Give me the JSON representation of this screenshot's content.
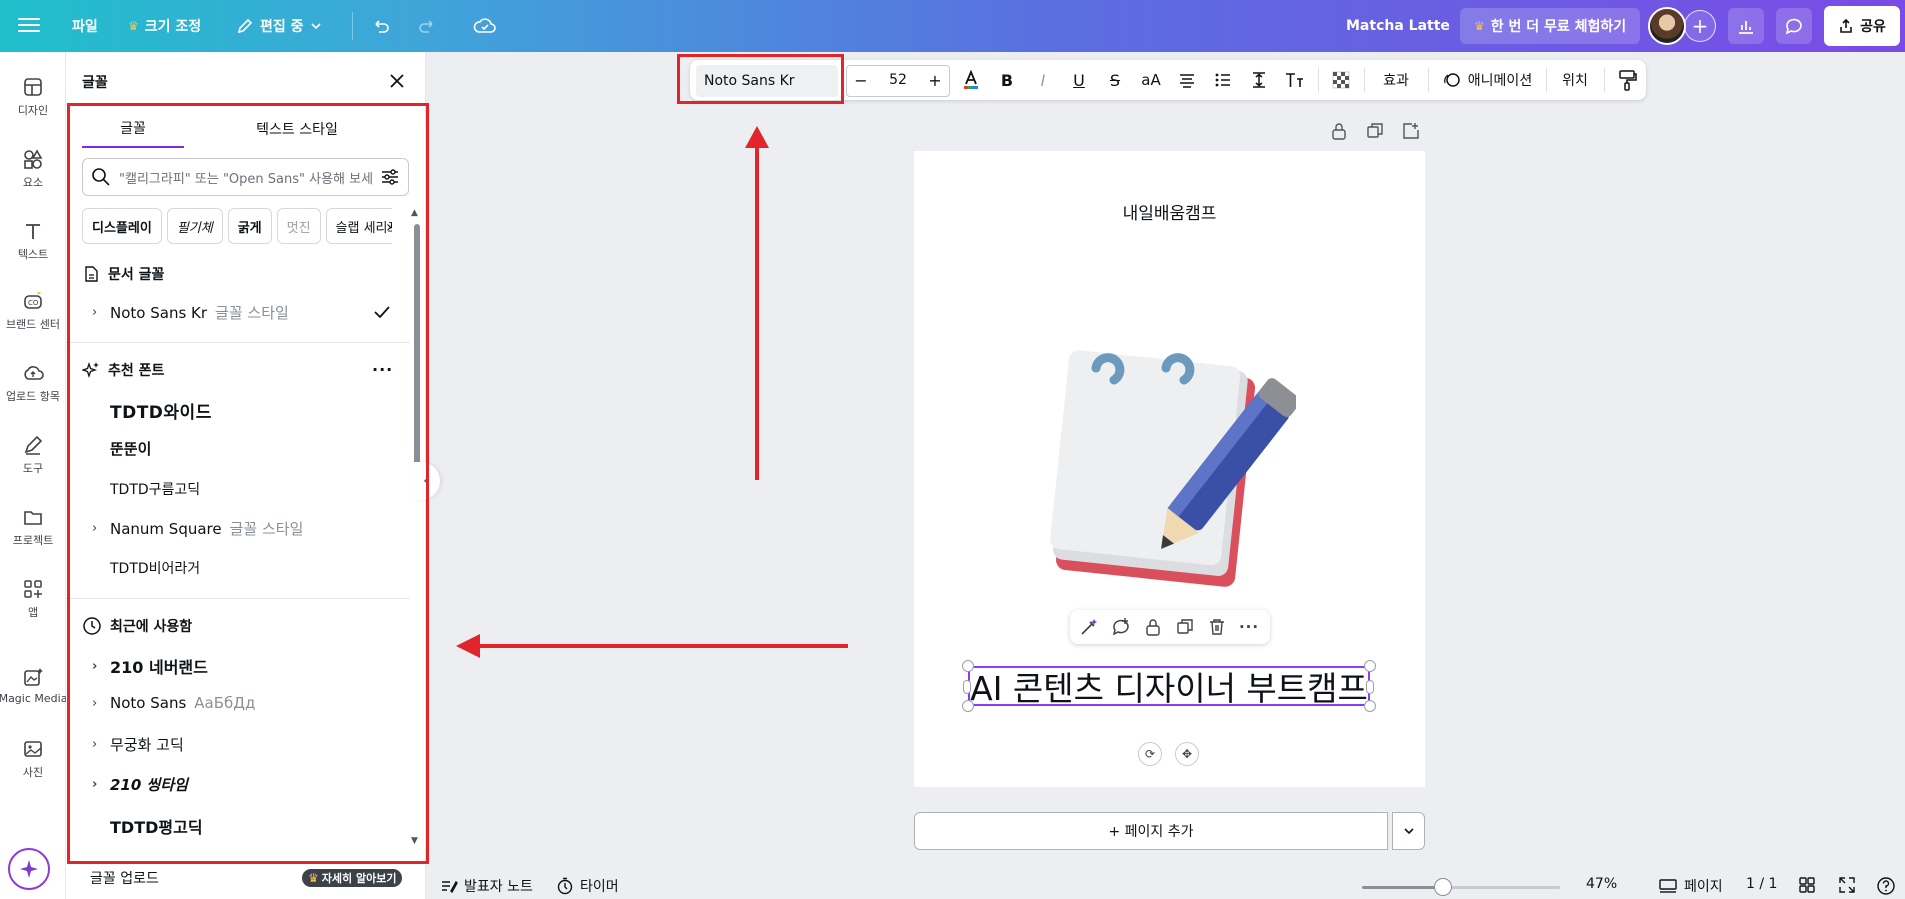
{
  "topbar": {
    "file": "파일",
    "resize": "크기 조정",
    "editing": "편집 중",
    "project_name": "Matcha Latte",
    "trial": "한 번 더 무료 체험하기",
    "share": "공유"
  },
  "rail": {
    "items": [
      {
        "label": "디자인",
        "icon": "layout-icon"
      },
      {
        "label": "요소",
        "icon": "shapes-icon"
      },
      {
        "label": "텍스트",
        "icon": "text-t-icon"
      },
      {
        "label": "브랜드 센터",
        "icon": "brand-icon"
      },
      {
        "label": "업로드 항목",
        "icon": "cloud-upload-icon"
      },
      {
        "label": "도구",
        "icon": "pen-tool-icon"
      },
      {
        "label": "프로젝트",
        "icon": "folder-icon"
      },
      {
        "label": "앱",
        "icon": "apps-icon"
      },
      {
        "label": "Magic Media",
        "icon": "magic-media-icon"
      },
      {
        "label": "사진",
        "icon": "photo-icon"
      }
    ]
  },
  "panel": {
    "title": "글꼴",
    "tabs": [
      "글꼴",
      "텍스트 스타일"
    ],
    "search_placeholder": "\"캘리그라피\" 또는 \"Open Sans\" 사용해 보세요",
    "chips": [
      "디스플레이",
      "필기체",
      "굵게",
      "멋진",
      "슬랩 세리프"
    ],
    "doc_fonts_heading": "문서 글꼴",
    "doc_fonts": [
      {
        "name": "Noto Sans Kr",
        "style": "글꼴 스타일"
      }
    ],
    "recommended_heading": "추천 폰트",
    "recommended": [
      {
        "name": "TDTD와이드",
        "style": ""
      },
      {
        "name": "뚠뚠이",
        "style": ""
      },
      {
        "name": "TDTD구름고딕",
        "style": ""
      },
      {
        "name": "Nanum Square",
        "style": "글꼴 스타일"
      },
      {
        "name": "TDTD비어라거",
        "style": ""
      }
    ],
    "recent_heading": "최근에 사용함",
    "recent": [
      {
        "name": "210 네버랜드",
        "style": ""
      },
      {
        "name": "Noto Sans",
        "style": "АаБбДд"
      },
      {
        "name": "무궁화 고딕",
        "style": ""
      },
      {
        "name": "210 씽타임",
        "style": ""
      },
      {
        "name": "TDTD평고딕",
        "style": ""
      }
    ],
    "upload": "글꼴 업로드",
    "learn_more": "자세히 알아보기"
  },
  "toolbar": {
    "font": "Noto Sans Kr",
    "size": "52",
    "effects": "효과",
    "animation": "애니메이션",
    "position": "위치"
  },
  "canvas": {
    "header_text": "내일배움캠프",
    "title_text": "AI 콘텐츠 디자이너 부트캠프",
    "add_page": "+ 페이지 추가"
  },
  "bottombar": {
    "notes": "발표자 노트",
    "timer": "타이머",
    "zoom": "47%",
    "pages_label": "페이지",
    "page_count": "1 / 1"
  },
  "colors": {
    "accent": "#7d2ae8",
    "annotation_red": "#e0262b"
  }
}
